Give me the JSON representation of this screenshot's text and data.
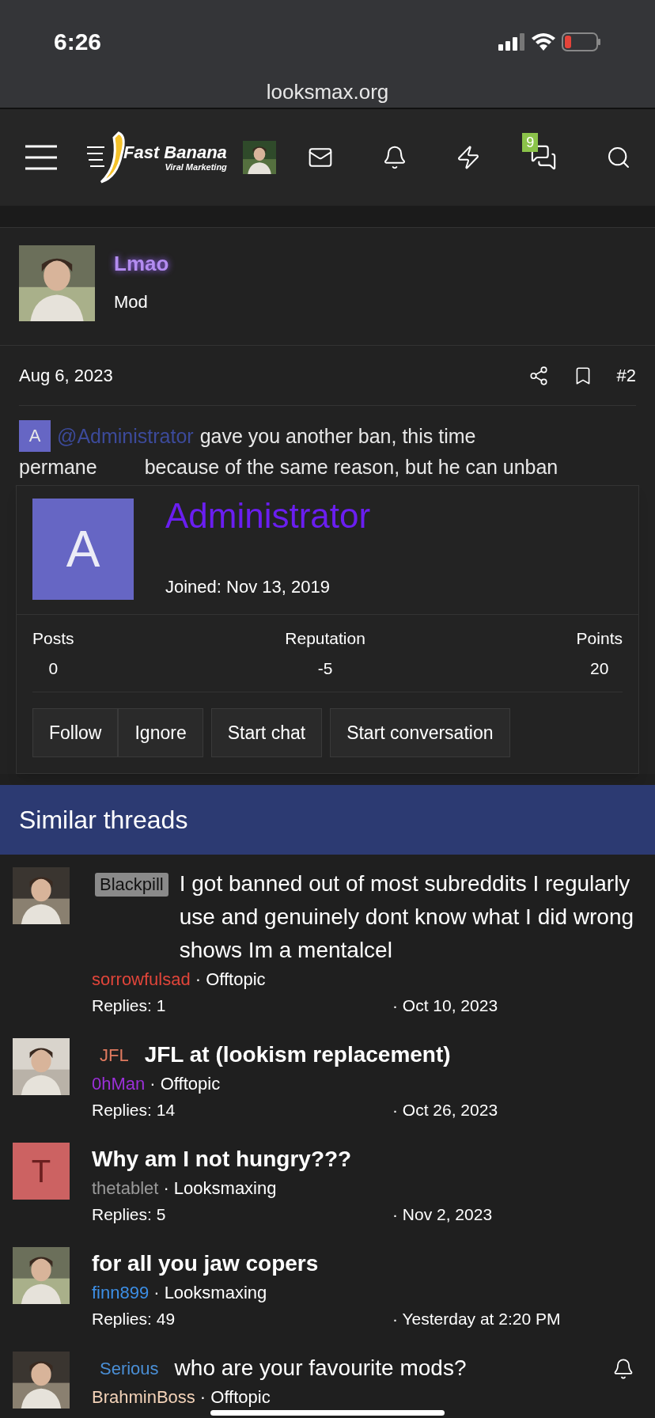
{
  "status_bar": {
    "time": "6:26",
    "url": "looksmax.org"
  },
  "header": {
    "logo_title": "Fast Banana",
    "logo_subtitle": "Viral Marketing",
    "chat_badge": "9"
  },
  "post": {
    "author": "Lmao",
    "role": "Mod",
    "date": "Aug 6, 2023",
    "number": "#2",
    "mention_avatar": "A",
    "mention": "@Administrator",
    "text_line_1": "gave you another ban, this time",
    "text_line_2_parts": [
      "permane",
      "because of the same reason, but he can unban"
    ]
  },
  "popup": {
    "avatar_letter": "A",
    "name": "Administrator",
    "joined": "Joined: Nov 13, 2019",
    "stats": [
      {
        "label": "Posts",
        "value": "0"
      },
      {
        "label": "Reputation",
        "value": "-5"
      },
      {
        "label": "Points",
        "value": "20"
      }
    ],
    "buttons": [
      "Follow",
      "Ignore",
      "Start chat",
      "Start conversation"
    ]
  },
  "similar_threads": {
    "title": "Similar threads",
    "threads": [
      {
        "prefix": {
          "text": "Blackpill",
          "kind": "dark"
        },
        "title": "I got banned out of most subreddits I regularly use and genuinely dont know what I did wrong shows Im a mentalcel",
        "unread": false,
        "author": "sorrowfulsad",
        "color": "#e0453a",
        "forum": "· Offtopic",
        "replies": "Replies: 1",
        "date": "· Oct 10, 2023"
      },
      {
        "prefix": {
          "text": "JFL",
          "kind": "orange"
        },
        "title": "JFL at (lookism replacement)",
        "unread": true,
        "author": "0hMan",
        "color": "#9b30d9",
        "forum": "· Offtopic",
        "replies": "Replies: 14",
        "date": "· Oct 26, 2023"
      },
      {
        "avatar": {
          "kind": "letter",
          "letter": "T"
        },
        "title": "Why am I not hungry???",
        "unread": true,
        "author": "thetablet",
        "color": "#9a9a9a",
        "forum": "· Looksmaxing",
        "replies": "Replies: 5",
        "date": "· Nov 2, 2023"
      },
      {
        "title": "for all you jaw copers",
        "unread": true,
        "author": "finn899",
        "color": "#3d8fe6",
        "forum": "· Looksmaxing",
        "replies": "Replies: 49",
        "date": "· Yesterday at 2:20 PM"
      },
      {
        "prefix": {
          "text": "Serious",
          "kind": "blue"
        },
        "title": "who are your favourite mods?",
        "unread": false,
        "author": "BrahminBoss",
        "color": "#f3d2b8",
        "forum": "· Offtopic",
        "watched": true
      }
    ]
  }
}
